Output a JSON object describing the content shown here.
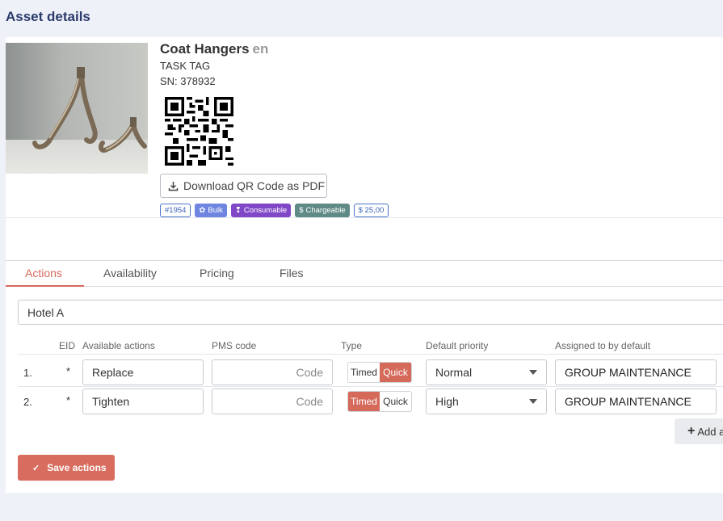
{
  "page": {
    "title": "Asset details"
  },
  "asset": {
    "name": "Coat Hangers",
    "lang": "en",
    "tag": "TASK TAG",
    "sn": "SN: 378932",
    "download_label": "Download QR Code as PDF",
    "badges": {
      "id": "#1954",
      "bulk": "Bulk",
      "consumable": "Consumable",
      "chargeable": "Chargeable",
      "price": "$ 25,00"
    }
  },
  "tabs": [
    "Actions",
    "Availability",
    "Pricing",
    "Files"
  ],
  "active_tab": "Actions",
  "location": "Hotel A",
  "table": {
    "headers": {
      "eid": "EID",
      "actions": "Available actions",
      "pms": "PMS code",
      "type": "Type",
      "priority": "Default priority",
      "assigned": "Assigned to by default"
    },
    "rows": [
      {
        "num": "1.",
        "eid": "*",
        "action": "Replace",
        "pms_placeholder": "Code",
        "type_timed": "Timed",
        "type_quick": "Quick",
        "type_selected": "Quick",
        "priority": "Normal",
        "assigned": "GROUP MAINTENANCE"
      },
      {
        "num": "2.",
        "eid": "*",
        "action": "Tighten",
        "pms_placeholder": "Code",
        "type_timed": "Timed",
        "type_quick": "Quick",
        "type_selected": "Timed",
        "priority": "High",
        "assigned": "GROUP MAINTENANCE"
      }
    ]
  },
  "buttons": {
    "add": "Add a",
    "save": "Save actions"
  },
  "colors": {
    "accent": "#d5695a",
    "title": "#2b3a6b"
  }
}
